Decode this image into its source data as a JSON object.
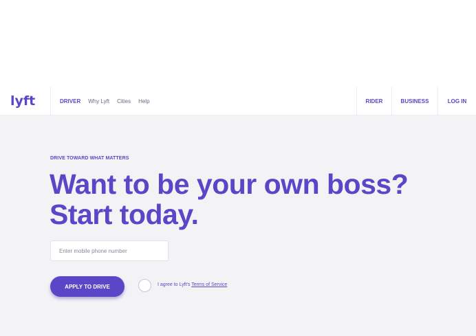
{
  "brand": {
    "logo_text": "lyft",
    "accent_color": "#5a46c6"
  },
  "nav": {
    "left_items": [
      "DRIVER",
      "Why Lyft",
      "Cities",
      "Help"
    ],
    "right_items": [
      "RIDER",
      "BUSINESS",
      "LOG IN"
    ]
  },
  "hero": {
    "eyebrow": "DRIVE TOWARD WHAT MATTERS",
    "headline_line1": "Want to be your own boss?",
    "headline_line2": "Start today.",
    "phone_placeholder": "Enter mobile phone number",
    "phone_value": "",
    "apply_label": "APPLY TO DRIVE",
    "agree_prefix": "I agree to Lyft's ",
    "tos_label": "Terms of Service"
  }
}
